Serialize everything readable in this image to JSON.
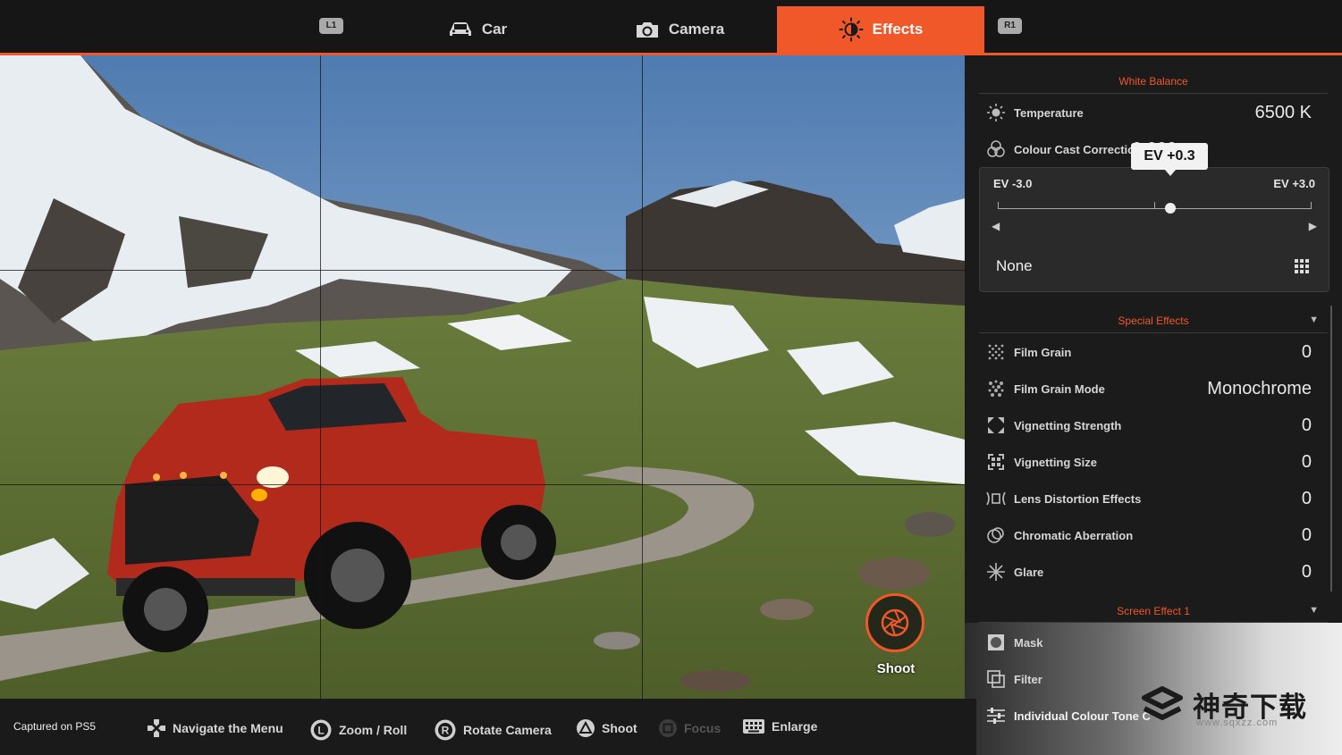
{
  "top_bar": {
    "left_button": "L1",
    "right_button": "R1",
    "tabs": [
      {
        "label": "Car",
        "icon": "car-icon",
        "active": false
      },
      {
        "label": "Camera",
        "icon": "camera-icon",
        "active": false
      },
      {
        "label": "Effects",
        "icon": "brightness-icon",
        "active": true
      }
    ]
  },
  "viewport": {
    "shoot_label": "Shoot"
  },
  "panel": {
    "white_balance": {
      "title": "White Balance",
      "items": [
        {
          "label": "Temperature",
          "value": "6500 K",
          "icon": "sun-icon"
        },
        {
          "label": "Colour Cast Correction",
          "value": "0.000",
          "icon": "color-circles-icon"
        }
      ]
    },
    "ev_popup": {
      "tooltip": "EV +0.3",
      "min_label": "EV -3.0",
      "max_label": "EV +3.0",
      "value": 0.3,
      "min": -3.0,
      "max": 3.0,
      "preset": "None"
    },
    "special_effects": {
      "title": "Special Effects",
      "items": [
        {
          "label": "Film Grain",
          "value": "0",
          "icon": "grain-icon"
        },
        {
          "label": "Film Grain Mode",
          "value": "Monochrome",
          "icon": "grain-mode-icon"
        },
        {
          "label": "Vignetting Strength",
          "value": "0",
          "icon": "vignette-strength-icon"
        },
        {
          "label": "Vignetting Size",
          "value": "0",
          "icon": "vignette-size-icon"
        },
        {
          "label": "Lens Distortion Effects",
          "value": "0",
          "icon": "lens-distortion-icon"
        },
        {
          "label": "Chromatic Aberration",
          "value": "0",
          "icon": "chromatic-icon"
        },
        {
          "label": "Glare",
          "value": "0",
          "icon": "glare-icon"
        }
      ]
    },
    "screen_effect": {
      "title": "Screen Effect 1",
      "items": [
        {
          "label": "Mask",
          "icon": "mask-icon"
        },
        {
          "label": "Filter",
          "icon": "filter-icon"
        },
        {
          "label": "Individual Colour Tone C",
          "icon": "sliders-icon"
        }
      ]
    }
  },
  "bottom_bar": {
    "captured": "Captured on PS5",
    "hints": [
      {
        "label": "Navigate the Menu",
        "icon": "dpad-icon",
        "enabled": true
      },
      {
        "label": "Zoom / Roll",
        "icon": "left-stick-icon",
        "enabled": true
      },
      {
        "label": "Rotate Camera",
        "icon": "right-stick-icon",
        "enabled": true
      },
      {
        "label": "Shoot",
        "icon": "triangle-icon",
        "enabled": true
      },
      {
        "label": "Focus",
        "icon": "square-icon",
        "enabled": false
      },
      {
        "label": "Enlarge",
        "icon": "keyboard-icon",
        "enabled": true
      }
    ]
  },
  "watermark": {
    "text": "神奇下载",
    "url": "www.sqxzz.com"
  },
  "colors": {
    "accent": "#f0582a",
    "panel_bg": "#1b1b1b",
    "topbar_bg": "#161616"
  }
}
